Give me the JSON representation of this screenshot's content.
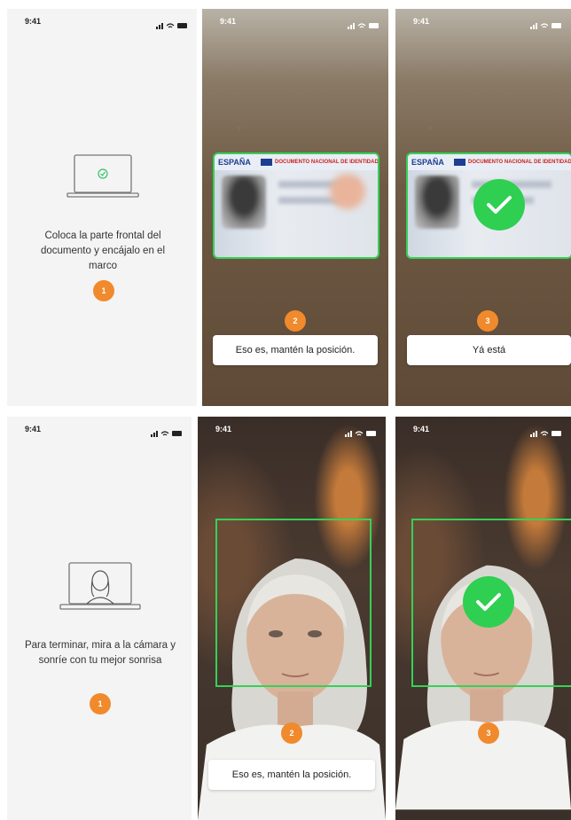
{
  "status_time": "9:41",
  "doc": {
    "screen1": {
      "instruction": "Coloca la parte frontal del documento y encájalo en el marco",
      "step": "1"
    },
    "screen2": {
      "step": "2",
      "message": "Eso es, mantén la posición."
    },
    "screen3": {
      "step": "3",
      "message": "Yá está"
    },
    "card": {
      "country": "ESPAÑA",
      "doc_label": "DOCUMENTO NACIONAL DE IDENTIDAD"
    }
  },
  "selfie": {
    "screen1": {
      "instruction": "Para terminar, mira a la cámara y sonríe con tu mejor sonrisa",
      "step": "1"
    },
    "screen2": {
      "step": "2",
      "message": "Eso es, mantén la posición."
    },
    "screen3": {
      "step": "3"
    }
  },
  "colors": {
    "accent": "#f08a2c",
    "success": "#2fcf52",
    "frame": "#35d157"
  },
  "icons": [
    "signal-icon",
    "wifi-icon",
    "battery-icon",
    "laptop-icon",
    "check-icon"
  ]
}
